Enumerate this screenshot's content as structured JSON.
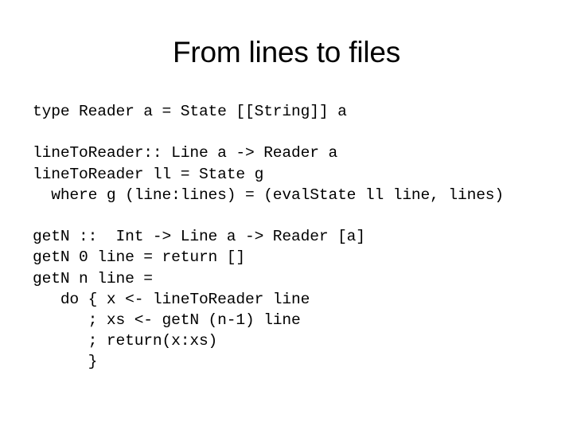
{
  "slide": {
    "title": "From lines to files",
    "background_color": "#ffffff",
    "text_color": "#000000"
  },
  "code": {
    "blocks": [
      {
        "name": "type-alias-block",
        "lines": [
          "type Reader a = State [[String]] a"
        ]
      },
      {
        "name": "line-to-reader-block",
        "lines": [
          "lineToReader:: Line a -> Reader a",
          "lineToReader ll = State g",
          "  where g (line:lines) = (evalState ll line, lines)"
        ]
      },
      {
        "name": "get-n-block",
        "lines": [
          "getN ::  Int -> Line a -> Reader [a]",
          "getN 0 line = return []",
          "getN n line =",
          "   do { x <- lineToReader line",
          "      ; xs <- getN (n-1) line",
          "      ; return(x:xs)",
          "      }"
        ]
      }
    ]
  }
}
